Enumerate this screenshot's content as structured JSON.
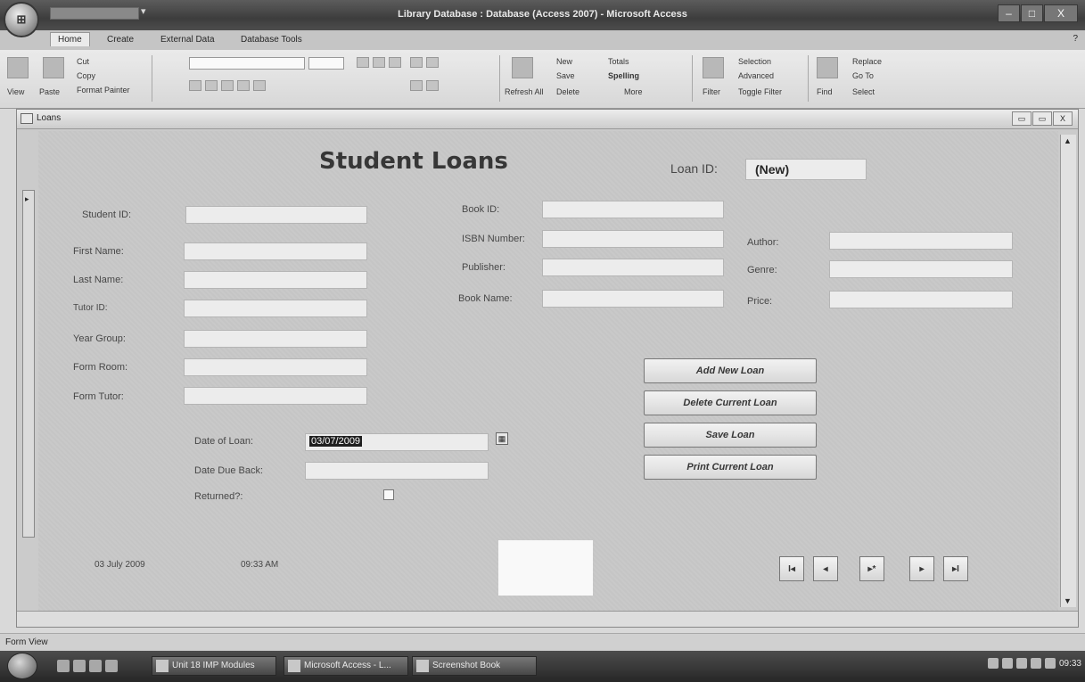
{
  "window": {
    "title": "Library Database : Database (Access 2007) - Microsoft Access",
    "controls": [
      "–",
      "□",
      "X"
    ]
  },
  "ribbon_tabs": [
    "Home",
    "Create",
    "External Data",
    "Database Tools"
  ],
  "ribbon": {
    "clipboard": {
      "paste": "Paste",
      "cut": "Cut",
      "copy": "Copy",
      "format_painter": "Format Painter"
    },
    "views": {
      "view": "View"
    },
    "records": {
      "new": "New",
      "save": "Save",
      "delete": "Delete",
      "totals": "Totals",
      "spelling": "Spelling",
      "more": "More"
    },
    "sort_filter": {
      "filter": "Filter",
      "selection": "Selection",
      "advanced": "Advanced",
      "toggle_filter": "Toggle Filter"
    },
    "find": {
      "find": "Find",
      "replace": "Replace",
      "goto": "Go To",
      "select": "Select"
    },
    "refresh": "Refresh All"
  },
  "form_window": {
    "tab_label": "Loans",
    "controls": [
      "▭",
      "▭",
      "X"
    ]
  },
  "form": {
    "title": "Student Loans",
    "loan_id_label": "Loan ID:",
    "loan_id_value": "(New)",
    "student_fields": [
      {
        "label": "Student ID:",
        "value": ""
      },
      {
        "label": "First Name:",
        "value": ""
      },
      {
        "label": "Last Name:",
        "value": ""
      },
      {
        "label": "Tutor ID:",
        "value": ""
      },
      {
        "label": "Year Group:",
        "value": ""
      },
      {
        "label": "Form Room:",
        "value": ""
      },
      {
        "label": "Form Tutor:",
        "value": ""
      }
    ],
    "book_fields": [
      {
        "label": "Book ID:",
        "value": ""
      },
      {
        "label": "ISBN Number:",
        "value": ""
      },
      {
        "label": "Publisher:",
        "value": ""
      },
      {
        "label": "Book Name:",
        "value": ""
      }
    ],
    "book_extra_fields": [
      {
        "label": "Author:",
        "value": ""
      },
      {
        "label": "Genre:",
        "value": ""
      },
      {
        "label": "Price:",
        "value": ""
      }
    ],
    "date_of_loan_label": "Date of Loan:",
    "date_of_loan_value": "03/07/2009",
    "date_due_label": "Date Due Back:",
    "date_due_value": "",
    "returned_label": "Returned?:",
    "buttons": {
      "add": "Add New Loan",
      "delete": "Delete Current Loan",
      "save": "Save Loan",
      "print": "Print Current Loan"
    },
    "footer_date": "03 July 2009",
    "footer_time": "09:33 AM",
    "nav": {
      "first": "I◂",
      "prev": "◂",
      "new": "▸*",
      "next": "▸",
      "last": "▸I"
    }
  },
  "status_bar": {
    "text": "Form View"
  },
  "taskbar": {
    "items": [
      "Unit 18 IMP Modules",
      "Microsoft Access - L...",
      "Screenshot Book"
    ],
    "clock": "09:33"
  }
}
